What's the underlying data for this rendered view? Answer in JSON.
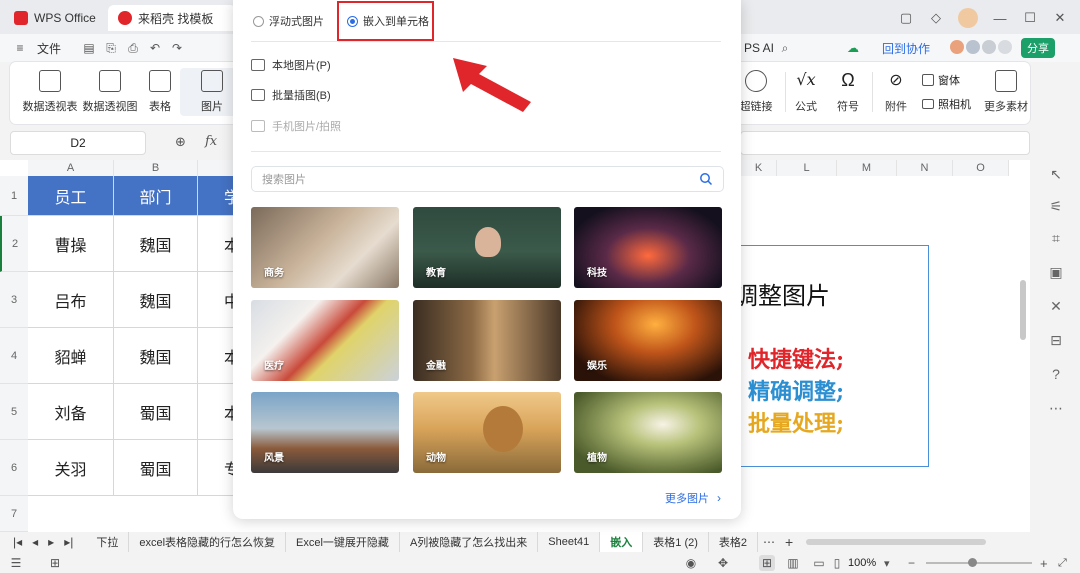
{
  "titlebar": {
    "tabs": [
      {
        "label": "WPS Office",
        "color": "#e0262a"
      },
      {
        "label": "来稻壳 找模板",
        "color": "#e0262a"
      }
    ]
  },
  "menubar": {
    "file_label": "文件",
    "wps_ai": "PS AI",
    "collab": "回到协作",
    "share": "分享"
  },
  "ribbon": {
    "left": [
      {
        "label": "数据透视表"
      },
      {
        "label": "数据透视图"
      },
      {
        "label": "表格"
      },
      {
        "label": "图片"
      }
    ],
    "right": [
      {
        "label": "超链接"
      },
      {
        "label": "公式"
      },
      {
        "label": "符号"
      },
      {
        "label": "附件"
      },
      {
        "label": "窗体"
      },
      {
        "label": "照相机"
      },
      {
        "label": "更多素材"
      }
    ]
  },
  "formula": {
    "namebox": "D2",
    "fx": "fx"
  },
  "grid": {
    "columns": [
      "A",
      "B",
      "K",
      "L",
      "M",
      "N",
      "O"
    ],
    "rows": [
      "1",
      "2",
      "3",
      "4",
      "5",
      "6",
      "7"
    ],
    "header": [
      "员工",
      "部门",
      "学"
    ],
    "data": [
      [
        "曹操",
        "魏国",
        "本"
      ],
      [
        "吕布",
        "魏国",
        "中"
      ],
      [
        "貂蝉",
        "魏国",
        "本"
      ],
      [
        "刘备",
        "蜀国",
        "本"
      ],
      [
        "关羽",
        "蜀国",
        "专"
      ]
    ],
    "textbox": {
      "title": "调整图片",
      "line1": "快捷键法;",
      "line2": "精确调整;",
      "line3": "批量处理;",
      "colors": {
        "line1": "#e0262a",
        "line2": "#2c8fd1",
        "line3": "#e6a820"
      }
    },
    "header_color": "#4472c4"
  },
  "popup": {
    "radio_float": "浮动式图片",
    "radio_embed": "嵌入到单元格",
    "local_image": "本地图片(P)",
    "batch_insert": "批量插图(B)",
    "phone_image": "手机图片/拍照",
    "search_placeholder": "搜索图片",
    "categories": [
      "商务",
      "教育",
      "科技",
      "医疗",
      "金融",
      "娱乐",
      "风景",
      "动物",
      "植物"
    ],
    "more": "更多图片"
  },
  "sheets": {
    "tabs": [
      "下拉",
      "excel表格隐藏的行怎么恢复",
      "Excel一键展开隐藏",
      "A列被隐藏了怎么找出来",
      "Sheet41",
      "嵌入",
      "表格1 (2)",
      "表格2"
    ],
    "active": "嵌入"
  },
  "status": {
    "zoom": "100%"
  }
}
